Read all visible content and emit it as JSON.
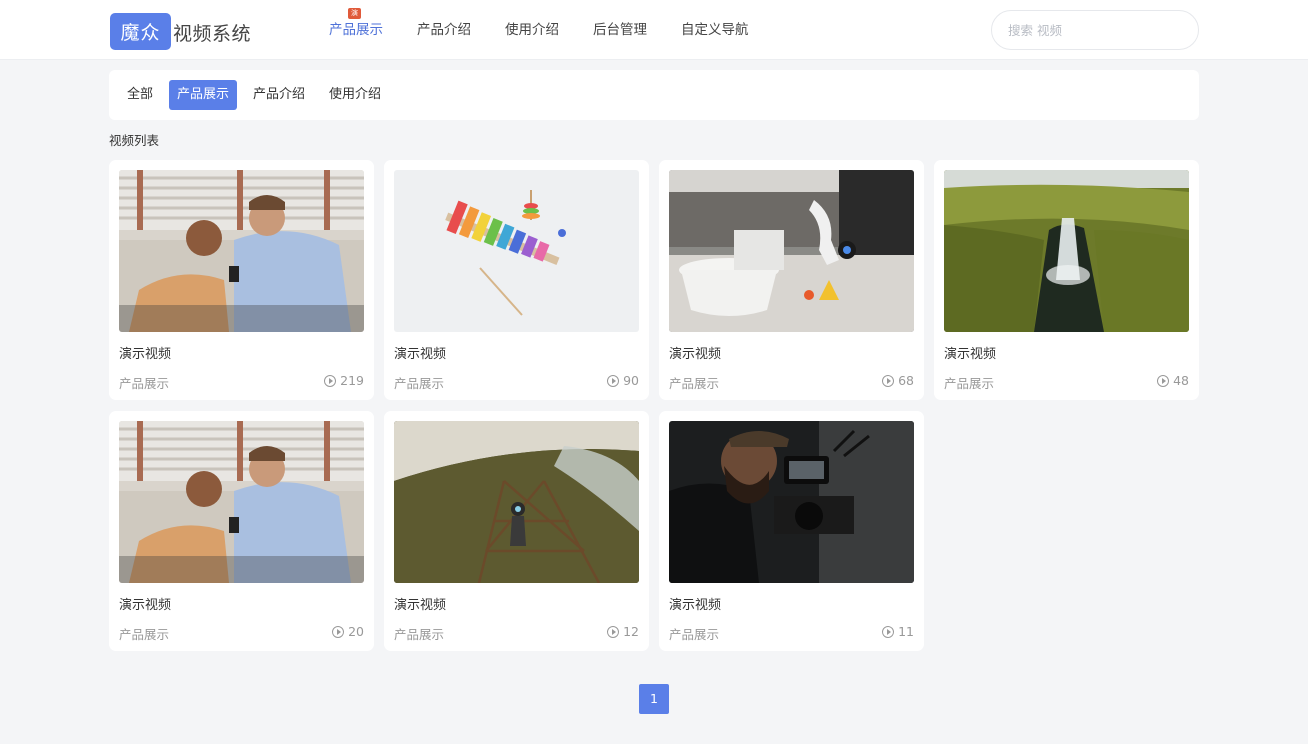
{
  "header": {
    "logo_box": "魔众",
    "logo_text": "视频系统",
    "logo_badge": "演示",
    "nav": [
      {
        "label": "产品展示",
        "active": true
      },
      {
        "label": "产品介绍",
        "active": false
      },
      {
        "label": "使用介绍",
        "active": false
      },
      {
        "label": "后台管理",
        "active": false
      },
      {
        "label": "自定义导航",
        "active": false
      }
    ],
    "search_placeholder": "搜索 视频"
  },
  "filter": {
    "chips": [
      {
        "label": "全部",
        "active": false
      },
      {
        "label": "产品展示",
        "active": true
      },
      {
        "label": "产品介绍",
        "active": false
      },
      {
        "label": "使用介绍",
        "active": false
      }
    ]
  },
  "section_title": "视频列表",
  "videos": [
    {
      "title": "演示视频",
      "category": "产品展示",
      "views": "219",
      "thumb": "friends-phone"
    },
    {
      "title": "演示视频",
      "category": "产品展示",
      "views": "90",
      "thumb": "xylophone"
    },
    {
      "title": "演示视频",
      "category": "产品展示",
      "views": "68",
      "thumb": "kitchen-robot"
    },
    {
      "title": "演示视频",
      "category": "产品展示",
      "views": "48",
      "thumb": "waterfall"
    },
    {
      "title": "演示视频",
      "category": "产品展示",
      "views": "20",
      "thumb": "friends-phone"
    },
    {
      "title": "演示视频",
      "category": "产品展示",
      "views": "12",
      "thumb": "tower-climb"
    },
    {
      "title": "演示视频",
      "category": "产品展示",
      "views": "11",
      "thumb": "camera-operator"
    }
  ],
  "pagination": {
    "current": "1"
  },
  "colors": {
    "accent": "#5a7fe8",
    "nav_active": "#4f72d8",
    "muted": "#999999",
    "badge": "#e05a3a"
  }
}
